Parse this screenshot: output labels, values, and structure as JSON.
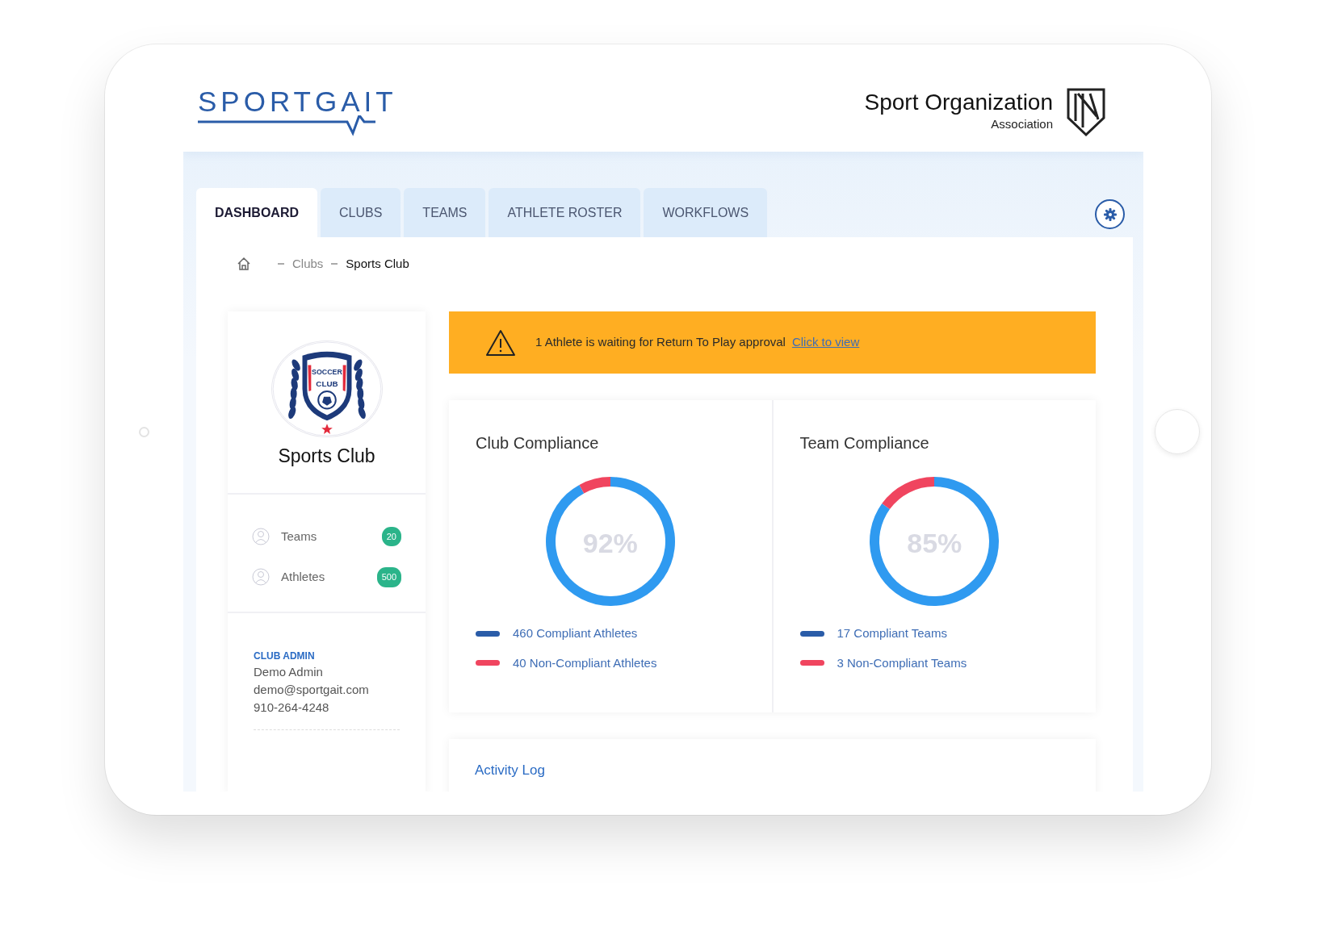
{
  "header": {
    "logo": "SPORTGAIT",
    "org_name": "Sport Organization",
    "org_sub": "Association"
  },
  "tabs": [
    {
      "label": "DASHBOARD",
      "selected": true
    },
    {
      "label": "CLUBS",
      "selected": false
    },
    {
      "label": "TEAMS",
      "selected": false
    },
    {
      "label": "ATHLETE ROSTER",
      "selected": false
    },
    {
      "label": "WORKFLOWS",
      "selected": false
    }
  ],
  "breadcrumb": [
    "Clubs",
    "Sports Club"
  ],
  "club": {
    "crest_text": [
      "SOCCER",
      "CLUB"
    ],
    "name": "Sports Club",
    "stats": [
      {
        "label": "Teams",
        "count": "20"
      },
      {
        "label": "Athletes",
        "count": "500"
      }
    ],
    "admin": {
      "heading": "CLUB ADMIN",
      "name": "Demo Admin",
      "email": "demo@sportgait.com",
      "phone": "910-264-4248"
    }
  },
  "alert": {
    "message": "1 Athlete is waiting for Return To Play approval",
    "link": "Click to view"
  },
  "compliance": [
    {
      "title": "Club Compliance",
      "center_label": "92%",
      "chart_data": {
        "type": "donut",
        "categories": [
          "460 Compliant Athletes",
          "40 Non-Compliant Athletes"
        ],
        "values": [
          460,
          40
        ]
      },
      "legend": [
        {
          "color": "#2a5ca8"
        },
        {
          "color": "#f0455f"
        }
      ]
    },
    {
      "title": "Team Compliance",
      "center_label": "85%",
      "chart_data": {
        "type": "donut",
        "categories": [
          "17 Compliant Teams",
          "3 Non-Compliant Teams"
        ],
        "values": [
          17,
          3
        ]
      },
      "legend": [
        {
          "color": "#2a5ca8"
        },
        {
          "color": "#f0455f"
        }
      ]
    }
  ],
  "activity_log": {
    "title": "Activity Log"
  }
}
